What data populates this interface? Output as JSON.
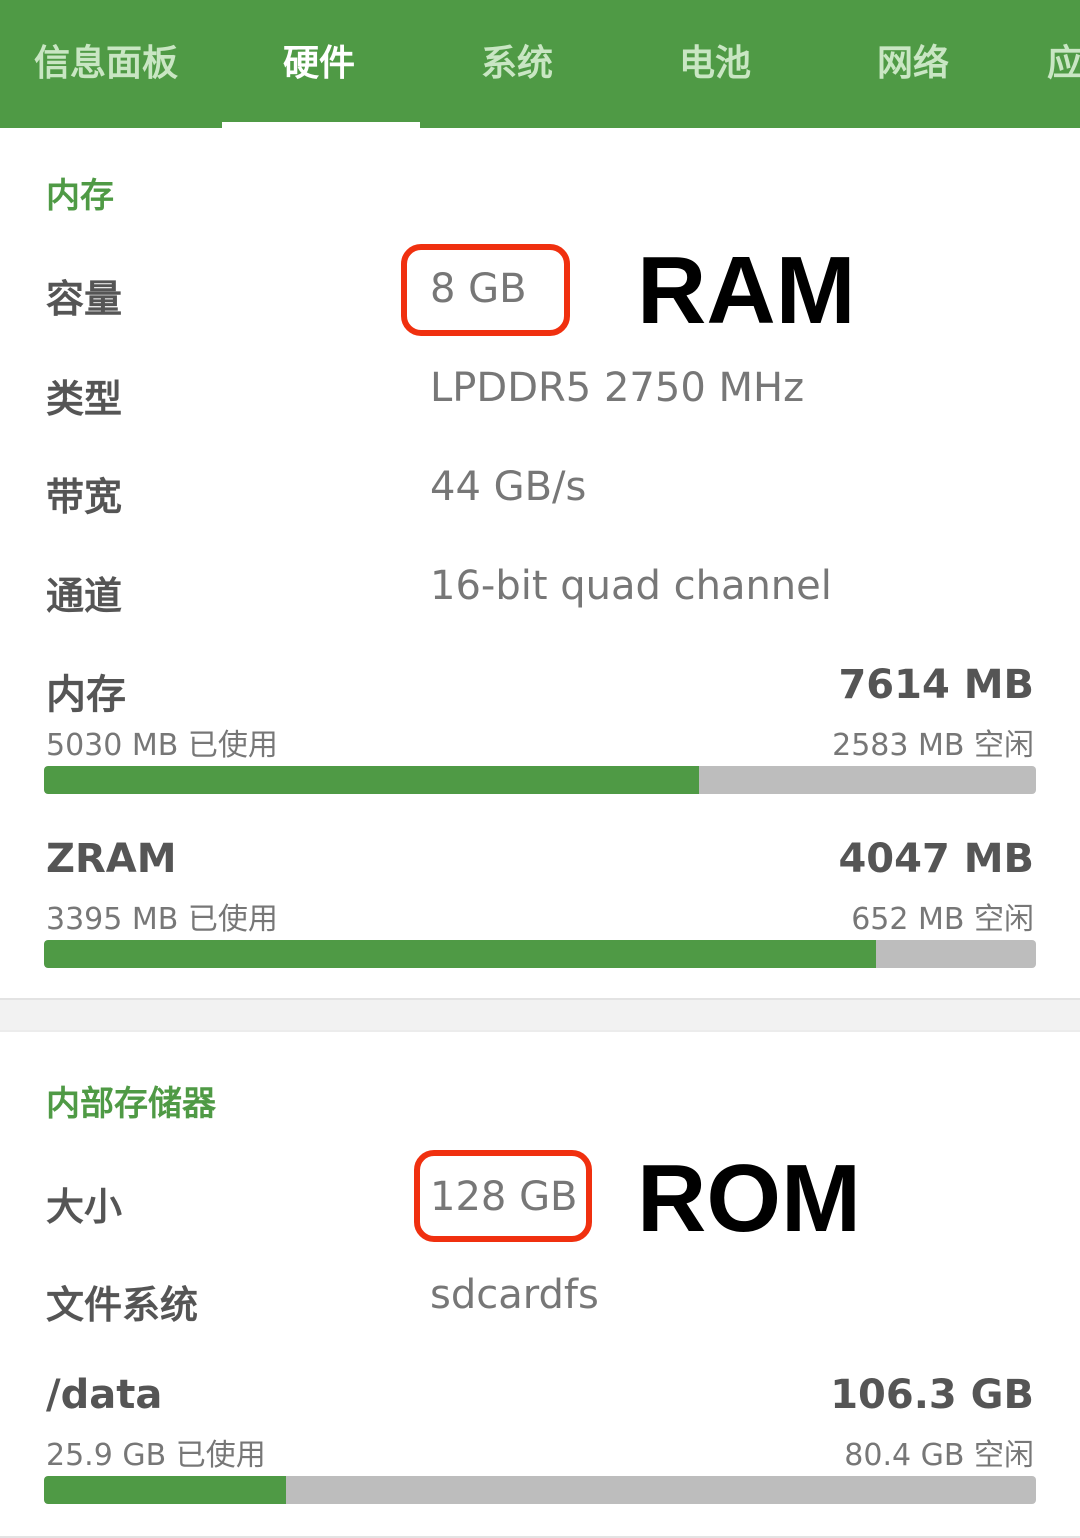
{
  "tabs": [
    {
      "label": "信息面板",
      "active": false
    },
    {
      "label": "硬件",
      "active": true
    },
    {
      "label": "系统",
      "active": false
    },
    {
      "label": "电池",
      "active": false
    },
    {
      "label": "网络",
      "active": false
    },
    {
      "label": "应",
      "active": false
    }
  ],
  "memory_section": {
    "title": "内存",
    "rows": [
      {
        "label": "容量",
        "value": "8 GB"
      },
      {
        "label": "类型",
        "value": "LPDDR5 2750 MHz"
      },
      {
        "label": "带宽",
        "value": "44 GB/s"
      },
      {
        "label": "通道",
        "value": "16-bit quad channel"
      }
    ],
    "usage": [
      {
        "title": "内存",
        "total": "7614 MB",
        "used": "5030 MB 已使用",
        "free": "2583 MB 空闲",
        "fraction": 0.66
      },
      {
        "title": "ZRAM",
        "total": "4047 MB",
        "used": "3395 MB 已使用",
        "free": "652 MB 空闲",
        "fraction": 0.839
      }
    ],
    "annotation": "RAM"
  },
  "storage_section": {
    "title": "内部存储器",
    "rows": [
      {
        "label": "大小",
        "value": "128 GB"
      },
      {
        "label": "文件系统",
        "value": "sdcardfs"
      }
    ],
    "usage": [
      {
        "title": "/data",
        "total": "106.3 GB",
        "used": "25.9 GB 已使用",
        "free": "80.4 GB 空闲",
        "fraction": 0.2436
      }
    ],
    "annotation": "ROM"
  },
  "colors": {
    "accent": "#4f9a45",
    "highlight": "#f0300f",
    "bar_bg": "#bdbdbd"
  }
}
